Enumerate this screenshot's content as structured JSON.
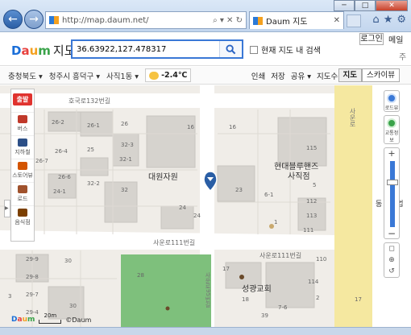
{
  "browser": {
    "url": "http://map.daum.net/",
    "addr_tools": "⌕ ▾ ✕ ↻",
    "tab_title": "Daum 지도",
    "tab_close": "✕",
    "back": "←",
    "forward": "→",
    "win_minimize": "─",
    "win_maximize": "□",
    "win_close": "✕",
    "home": "⌂",
    "favorites": "★",
    "settings": "⚙"
  },
  "header": {
    "logo": {
      "d": "D",
      "a": "a",
      "u": "u",
      "m": "m",
      "jido": "지도"
    },
    "search_value": "36.63922,127.478317",
    "search_icon": "search-icon",
    "checkbox_label": "현재 지도 내 검색",
    "login": "로그인",
    "mail": "메일",
    "cut": "주"
  },
  "toolbar": {
    "crumbs": [
      "충청북도 ▾",
      "청주시 흥덕구 ▾",
      "사직1동 ▾"
    ],
    "temperature": "-2.4℃",
    "tools": [
      "인쇄",
      "저장",
      "공유 ▾",
      "지도수정"
    ],
    "view_map": "지도",
    "view_sky": "스카이뷰"
  },
  "sidebar": {
    "brand": "출발",
    "items": [
      "버스",
      "지하철",
      "스토어뷰",
      "로드",
      "음식점"
    ]
  },
  "map": {
    "labels": {
      "road_top": "호국로132번길",
      "road_mid": "사운로111번길",
      "road_mid2": "사운로111번길",
      "road_right": "사운로",
      "building1": "대원자원",
      "building2": "현대블루핸즈",
      "building2b": "사직점",
      "building3": "성광교회",
      "cut_label": "동",
      "cut_label2": "공업",
      "vertical_road": "사운로95번길"
    },
    "parcels": [
      "26-2",
      "26-1",
      "26",
      "16",
      "16",
      "32-3",
      "26-7",
      "26-4",
      "32-1",
      "25",
      "26-6",
      "32-2",
      "32",
      "24-2",
      "24-1",
      "24",
      "24",
      "23",
      "115",
      "6-1",
      "1",
      "112",
      "113",
      "111",
      "110",
      "114",
      "5",
      "29-9",
      "29-8",
      "30",
      "28",
      "29-7",
      "17",
      "18",
      "29-4",
      "30",
      "3",
      "7-6",
      "17",
      "2",
      "39"
    ]
  },
  "controls": {
    "roadview": "로드뷰",
    "traffic": "교통정보",
    "zoom_in": "+",
    "zoom_out": "−",
    "zoom_level": 0.3,
    "tools": [
      "◻",
      "⊕",
      "↺"
    ]
  },
  "footer": {
    "scale_label": "20m",
    "copyright": "©Daum"
  },
  "colors": {
    "daum_blue": "#1a6ed8",
    "daum_red": "#e8423f",
    "daum_yellow": "#f4a120",
    "daum_green": "#3aa34a",
    "park_green": "#7ec07c",
    "zoom_blue": "#3a78d6"
  }
}
